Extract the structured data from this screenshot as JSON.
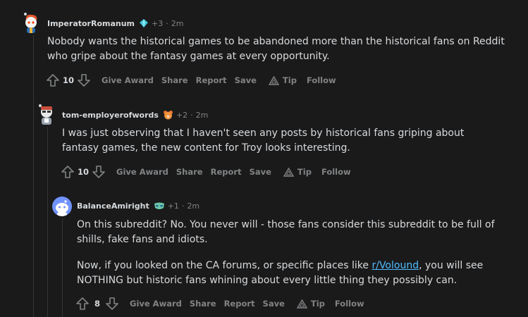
{
  "comments": [
    {
      "username": "ImperatorRomanum",
      "flair_icon": "diamond-flair-icon",
      "votes_info": "+3",
      "separator": "·",
      "time": "2m",
      "paragraphs": [
        "Nobody wants the historical games to be abandoned more than the historical fans on Reddit who gripe about the fantasy games at every opportunity."
      ],
      "score": "10",
      "actions": {
        "award": "Give Award",
        "share": "Share",
        "report": "Report",
        "save": "Save",
        "tip": "Tip",
        "follow": "Follow"
      }
    },
    {
      "username": "tom-employerofwords",
      "flair_icon": "bear-flair-icon",
      "votes_info": "+2",
      "separator": "·",
      "time": "2m",
      "paragraphs": [
        "I was just observing that I haven't seen any posts by historical fans griping about fantasy games, the new content for Troy looks interesting."
      ],
      "score": "10",
      "actions": {
        "award": "Give Award",
        "share": "Share",
        "report": "Report",
        "save": "Save",
        "tip": "Tip",
        "follow": "Follow"
      }
    },
    {
      "username": "BalanceAmiright",
      "flair_icon": "mask-flair-icon",
      "votes_info": "+1",
      "separator": "·",
      "time": "2m",
      "paragraph1": "On this subreddit? No. You never will - those fans consider this subreddit to be full of shills, fake fans and idiots.",
      "paragraph2_before": "Now, if you looked on the CA forums, or specific places like ",
      "paragraph2_link": "r/Volound",
      "paragraph2_after": ", you will see NOTHING but historic fans whining about every little thing they possibly can.",
      "score": "8",
      "actions": {
        "award": "Give Award",
        "share": "Share",
        "report": "Report",
        "save": "Save",
        "tip": "Tip",
        "follow": "Follow"
      }
    }
  ],
  "colors": {
    "background": "#1a1a1b",
    "text": "#d7dadc",
    "muted": "#818384",
    "link": "#4fbcff"
  }
}
